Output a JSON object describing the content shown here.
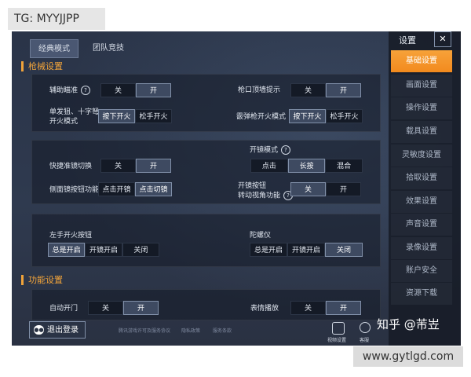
{
  "watermarks": {
    "top": "TG: MYYJJPP",
    "bottom": "www.gytlgd.com",
    "zhihu": "知乎 @芾岦"
  },
  "tabs": [
    {
      "label": "经典模式"
    },
    {
      "label": "团队竞技"
    }
  ],
  "sections": {
    "gun": "枪械设置",
    "func": "功能设置"
  },
  "panel1": {
    "aim_assist": {
      "label": "辅助瞄准",
      "options": [
        "关",
        "开"
      ],
      "selected": 1
    },
    "muzzle_hint": {
      "label": "枪口顶墙提示",
      "options": [
        "关",
        "开"
      ],
      "selected": 1
    },
    "single_fire": {
      "label1": "单发狙、十字弩",
      "label2": "开火模式",
      "options": [
        "按下开火",
        "松手开火"
      ],
      "selected": 0
    },
    "shotgun_fire": {
      "label": "霰弹枪开火模式",
      "options": [
        "按下开火",
        "松手开火"
      ],
      "selected": 0
    }
  },
  "panel2": {
    "quick_scope": {
      "label": "快捷准镜切换",
      "options": [
        "关",
        "开"
      ],
      "selected": 1
    },
    "scope_mode": {
      "label": "开镜模式",
      "options": [
        "点击",
        "长按",
        "混合"
      ],
      "selected": 1
    },
    "side_scope": {
      "label": "侧面镜按钮功能",
      "options": [
        "点击开镜",
        "点击切镜"
      ],
      "selected": 1
    },
    "scope_rotate": {
      "label1": "开镜按钮",
      "label2": "转动视角功能",
      "options": [
        "关",
        "开"
      ],
      "selected": 0
    }
  },
  "panel3": {
    "left_fire": {
      "label": "左手开火按钮",
      "options": [
        "总是开启",
        "开镜开启",
        "关闭"
      ],
      "selected": 0
    },
    "gyro": {
      "label": "陀螺仪",
      "options": [
        "总是开启",
        "开镜开启",
        "关闭"
      ],
      "selected": 2
    }
  },
  "panel4": {
    "auto_door": {
      "label": "自动开门",
      "options": [
        "关",
        "开"
      ],
      "selected": 1
    },
    "emote": {
      "label": "表情播放",
      "options": [
        "关",
        "开"
      ],
      "selected": 1
    }
  },
  "sidebar": {
    "title": "设置",
    "close": "✕",
    "items": [
      "基础设置",
      "画面设置",
      "操作设置",
      "载具设置",
      "灵敏度设置",
      "拾取设置",
      "效果设置",
      "声音设置",
      "录像设置",
      "账户安全",
      "资源下载"
    ],
    "active_index": 0
  },
  "bottom": {
    "logout": "退出登录",
    "links": [
      "腾讯游戏许可及服务协议",
      "隐私政策",
      "服务条款"
    ],
    "view_settings": "视频设置",
    "service": "客服"
  }
}
